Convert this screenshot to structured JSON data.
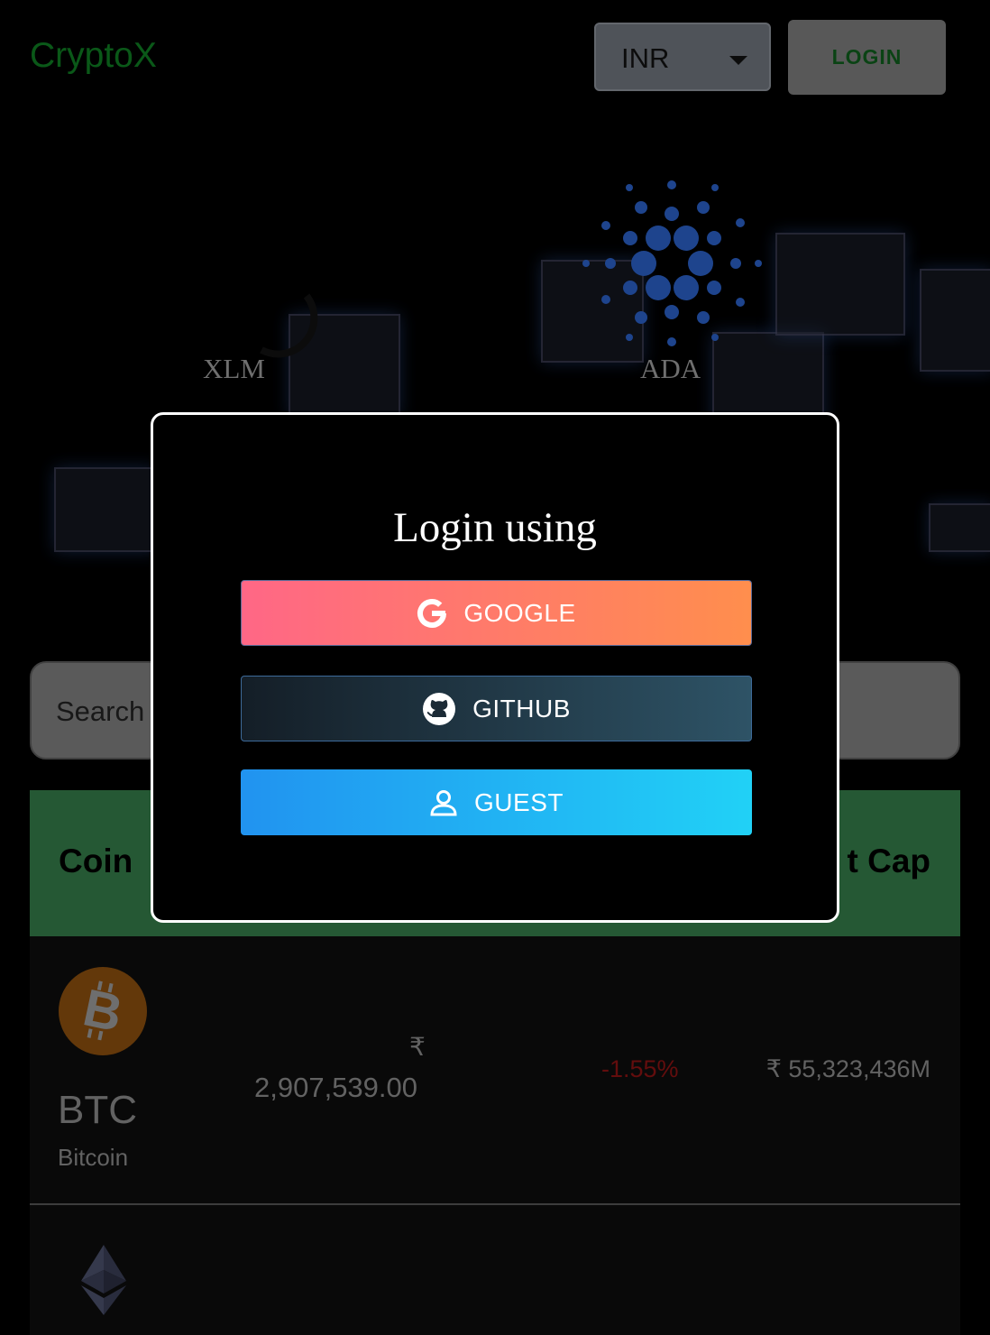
{
  "header": {
    "brand": "CryptoX",
    "currency": "INR",
    "login_label": "LOGIN"
  },
  "banner": {
    "coins": [
      "XLM",
      "ADA"
    ]
  },
  "search": {
    "placeholder": "Search"
  },
  "table": {
    "header_coin": "Coin",
    "header_market_cap": "t Cap",
    "rows": [
      {
        "symbol": "BTC",
        "name": "Bitcoin",
        "price_symbol": "₹",
        "price": "2,907,539.00",
        "change": "-1.55%",
        "market_cap": "₹ 55,323,436M"
      }
    ]
  },
  "modal": {
    "title": "Login using",
    "google_label": "GOOGLE",
    "github_label": "GITHUB",
    "guest_label": "GUEST"
  },
  "colors": {
    "brand": "#0f7a22",
    "table_header": "#347a49",
    "negative_change": "#8a1313"
  },
  "icons": [
    "caret-down-icon",
    "cardano-icon",
    "bitcoin-icon",
    "ethereum-icon",
    "google-icon",
    "github-icon",
    "user-icon"
  ]
}
